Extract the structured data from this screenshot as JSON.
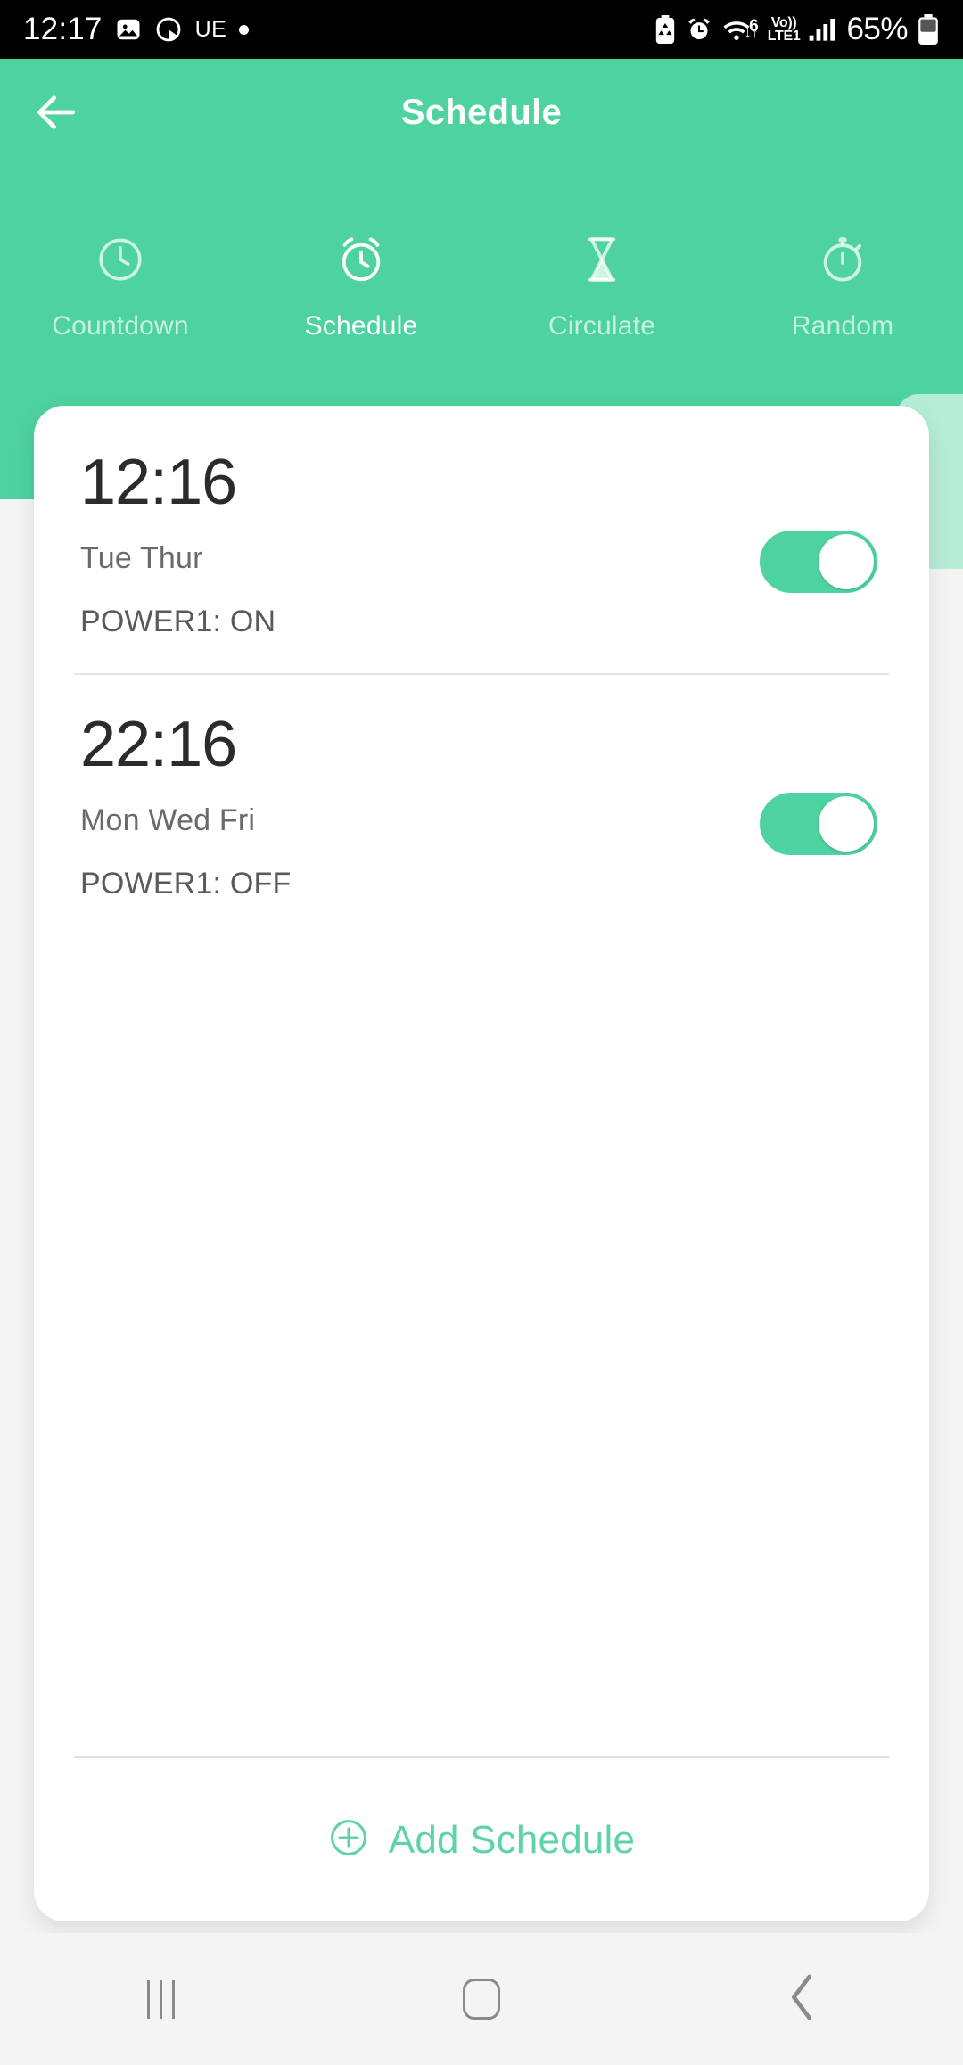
{
  "status_bar": {
    "clock": "12:17",
    "left_icons": [
      "image-icon",
      "circle-loading-icon"
    ],
    "carrier_label": "UE",
    "dot_indicator": "•",
    "right_icons": [
      "battery-saver-icon",
      "alarm-icon",
      "wifi-icon",
      "volte-icon",
      "signal-icon"
    ],
    "wifi_generation": "6",
    "wifi_arrows": "↓↑",
    "volte_line1": "Vo))",
    "volte_line2": "LTE1",
    "battery_percent": "65%"
  },
  "header": {
    "title": "Schedule",
    "back_icon": "back-arrow-icon",
    "background_color": "#4ed2a0"
  },
  "tabs": [
    {
      "label": "Countdown",
      "icon": "clock-icon",
      "active": false
    },
    {
      "label": "Schedule",
      "icon": "alarm-clock-icon",
      "active": true
    },
    {
      "label": "Circulate",
      "icon": "hourglass-icon",
      "active": false
    },
    {
      "label": "Random",
      "icon": "stopwatch-icon",
      "active": false
    }
  ],
  "drawer": {
    "handle_icon": "triangle-left-icon",
    "handle_color": "#b6edd6",
    "arrow_color": "#3b55d9"
  },
  "schedules": [
    {
      "time": "12:16",
      "days": "Tue Thur",
      "action": "POWER1: ON",
      "enabled": true
    },
    {
      "time": "22:16",
      "days": "Mon Wed Fri",
      "action": "POWER1: OFF",
      "enabled": true
    }
  ],
  "add_schedule": {
    "label": "Add Schedule",
    "icon": "plus-circle-icon",
    "color": "#5fd3a6"
  },
  "nav_bar": {
    "recents_icon": "recents-icon",
    "home_icon": "home-icon",
    "back_icon": "back-chevron-icon"
  },
  "colors": {
    "accent": "#4ed2a0",
    "card": "#ffffff",
    "page_background": "#f4f4f4",
    "text_primary": "#2b2b2b",
    "text_secondary": "#6a6a6a"
  }
}
